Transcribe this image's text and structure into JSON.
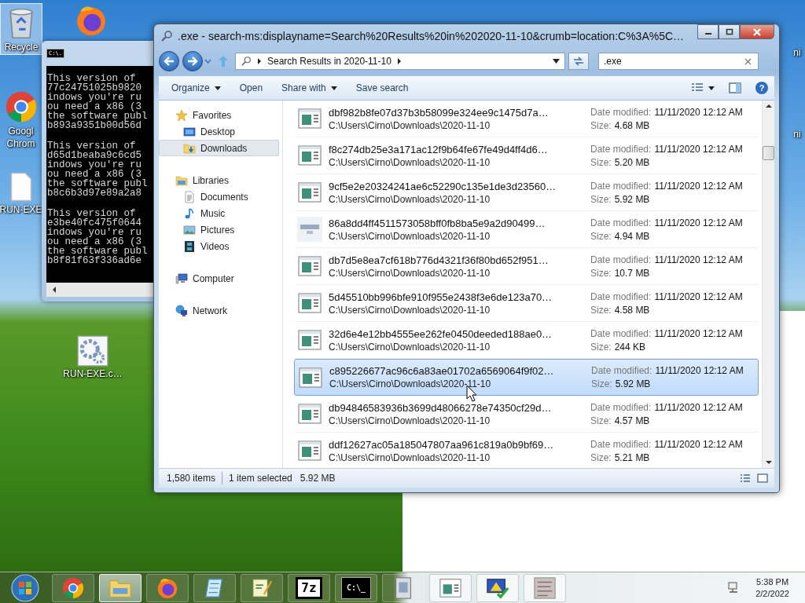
{
  "desktop_icons": [
    {
      "label": "Recycle",
      "kind": "bin",
      "selected": true
    },
    {
      "kind": "fox",
      "selected": false
    },
    {
      "label": "Googl",
      "label2": "Chrom",
      "kind": "globe",
      "selected": false
    },
    {
      "label": "RUN-EXE",
      "kind": "page",
      "selected": false
    },
    {
      "label": "RUN-EXE.c…",
      "kind": "gears",
      "selected": false
    },
    {
      "label": "ni",
      "kind": "label",
      "selected": false
    },
    {
      "label": "ni",
      "kind": "label",
      "selected": false
    }
  ],
  "console": {
    "icon_glyph": "C:\\.",
    "blocks": [
      [
        "This version of",
        "77c24751025b9820",
        "indows you're ru",
        "ou need a x86 (3",
        "the software publ",
        "b893a9351b00d56d"
      ],
      [
        "This version of",
        "d65d1beaba9c6cd5",
        "indows you're ru",
        "ou need a x86 (3",
        "the software publ",
        "b8c6b3d97e89a2a8"
      ],
      [
        "This version of",
        "e3be40fc475f0644",
        "indows you're ru",
        "ou need a x86 (3",
        "the software publ",
        "b8f81f63f336ad6e"
      ]
    ]
  },
  "explorer": {
    "title": ".exe - search-ms:displayname=Search%20Results%20in%202020-11-10&crumb=location:C%3A%5C…",
    "address": {
      "crumbs": [
        "Search Results in 2020-11-10"
      ]
    },
    "search": {
      "value": ".exe"
    },
    "toolbar": [
      {
        "label": "Organize",
        "dropdown": true
      },
      {
        "label": "Open",
        "dropdown": false
      },
      {
        "label": "Share with",
        "dropdown": true
      },
      {
        "label": "Save search",
        "dropdown": false
      }
    ],
    "help": "?",
    "sidebar": {
      "items": [
        {
          "label": "Favorites",
          "kind": "star",
          "selected": false,
          "children": [
            {
              "label": "Desktop",
              "kind": "desktop",
              "selected": false
            },
            {
              "label": "Downloads",
              "kind": "download",
              "selected": true
            }
          ]
        },
        {
          "label": "Libraries",
          "kind": "library",
          "selected": false,
          "children": [
            {
              "label": "Documents",
              "kind": "document",
              "selected": false
            },
            {
              "label": "Music",
              "kind": "music",
              "selected": false
            },
            {
              "label": "Pictures",
              "kind": "picture",
              "selected": false
            },
            {
              "label": "Videos",
              "kind": "video",
              "selected": false
            }
          ]
        },
        {
          "label": "Computer",
          "kind": "computer",
          "selected": false
        },
        {
          "label": "Network",
          "kind": "network",
          "selected": false
        }
      ]
    },
    "files": [
      {
        "name": "dbf982b8fe07d37b3b58099e324ee9c1475d7a…",
        "path": "C:\\Users\\Cirno\\Downloads\\2020-11-10",
        "date_label": "Date modified:",
        "date": "11/11/2020 12:12 AM",
        "size_label": "Size:",
        "size": "4.68 MB",
        "kind": "app",
        "selected": false
      },
      {
        "name": "f8c274db25e3a171ac12f9b64fe67fe49d4ff4d6…",
        "path": "C:\\Users\\Cirno\\Downloads\\2020-11-10",
        "date_label": "Date modified:",
        "date": "11/11/2020 12:12 AM",
        "size_label": "Size:",
        "size": "5.20 MB",
        "kind": "app",
        "selected": false
      },
      {
        "name": "9cf5e2e20324241ae6c52290c135e1de3d23560…",
        "path": "C:\\Users\\Cirno\\Downloads\\2020-11-10",
        "date_label": "Date modified:",
        "date": "11/11/2020 12:12 AM",
        "size_label": "Size:",
        "size": "5.92 MB",
        "kind": "app",
        "selected": false
      },
      {
        "name": "86a8dd4ff4511573058bff0fb8ba5e9a2d90499…",
        "path": "C:\\Users\\Cirno\\Downloads\\2020-11-10",
        "date_label": "Date modified:",
        "date": "11/11/2020 12:12 AM",
        "size_label": "Size:",
        "size": "4.94 MB",
        "kind": "thumbnail",
        "selected": false
      },
      {
        "name": "db7d5e8ea7cf618b776d4321f36f80bd652f951…",
        "path": "C:\\Users\\Cirno\\Downloads\\2020-11-10",
        "date_label": "Date modified:",
        "date": "11/11/2020 12:12 AM",
        "size_label": "Size:",
        "size": "10.7 MB",
        "kind": "app",
        "selected": false
      },
      {
        "name": "5d45510bb996bfe910f955e2438f3e6de123a70…",
        "path": "C:\\Users\\Cirno\\Downloads\\2020-11-10",
        "date_label": "Date modified:",
        "date": "11/11/2020 12:12 AM",
        "size_label": "Size:",
        "size": "4.58 MB",
        "kind": "app",
        "selected": false
      },
      {
        "name": "32d6e4e12bb4555ee262fe0450deeded188ae0…",
        "path": "C:\\Users\\Cirno\\Downloads\\2020-11-10",
        "date_label": "Date modified:",
        "date": "11/11/2020 12:12 AM",
        "size_label": "Size:",
        "size": "244 KB",
        "kind": "app",
        "selected": false
      },
      {
        "name": "c895226677ac96c6a83ae01702a6569064f9f02…",
        "path": "C:\\Users\\Cirno\\Downloads\\2020-11-10",
        "date_label": "Date modified:",
        "date": "11/11/2020 12:12 AM",
        "size_label": "Size:",
        "size": "5.92 MB",
        "kind": "app",
        "selected": true
      },
      {
        "name": "db94846583936b3699d48066278e74350cf29d…",
        "path": "C:\\Users\\Cirno\\Downloads\\2020-11-10",
        "date_label": "Date modified:",
        "date": "11/11/2020 12:12 AM",
        "size_label": "Size:",
        "size": "4.57 MB",
        "kind": "app",
        "selected": false
      },
      {
        "name": "ddf12627ac05a185047807aa961c819a0b9bf69…",
        "path": "C:\\Users\\Cirno\\Downloads\\2020-11-10",
        "date_label": "Date modified:",
        "date": "11/11/2020 12:12 AM",
        "size_label": "Size:",
        "size": "5.21 MB",
        "kind": "app",
        "selected": false
      }
    ],
    "status_bar": {
      "count": "1,580 items",
      "selection": "1 item selected",
      "selection_size": "5.92 MB"
    }
  },
  "taskbar": {
    "items": [
      {
        "kind": "globe",
        "active": false
      },
      {
        "kind": "folder",
        "active": true
      },
      {
        "kind": "fox",
        "active": false
      },
      {
        "kind": "notepad",
        "active": false
      },
      {
        "kind": "editor",
        "active": false
      },
      {
        "kind": "archive",
        "glyph": "7z",
        "active": false
      },
      {
        "kind": "terminal",
        "glyph": "C:\\_",
        "active": false
      },
      {
        "kind": "installer",
        "active": false
      },
      {
        "kind": "window",
        "active": false
      },
      {
        "kind": "monitor",
        "active": false
      },
      {
        "kind": "image",
        "active": false
      }
    ],
    "clock": {
      "time": "5:38 PM",
      "date": "2/2/2022"
    }
  }
}
